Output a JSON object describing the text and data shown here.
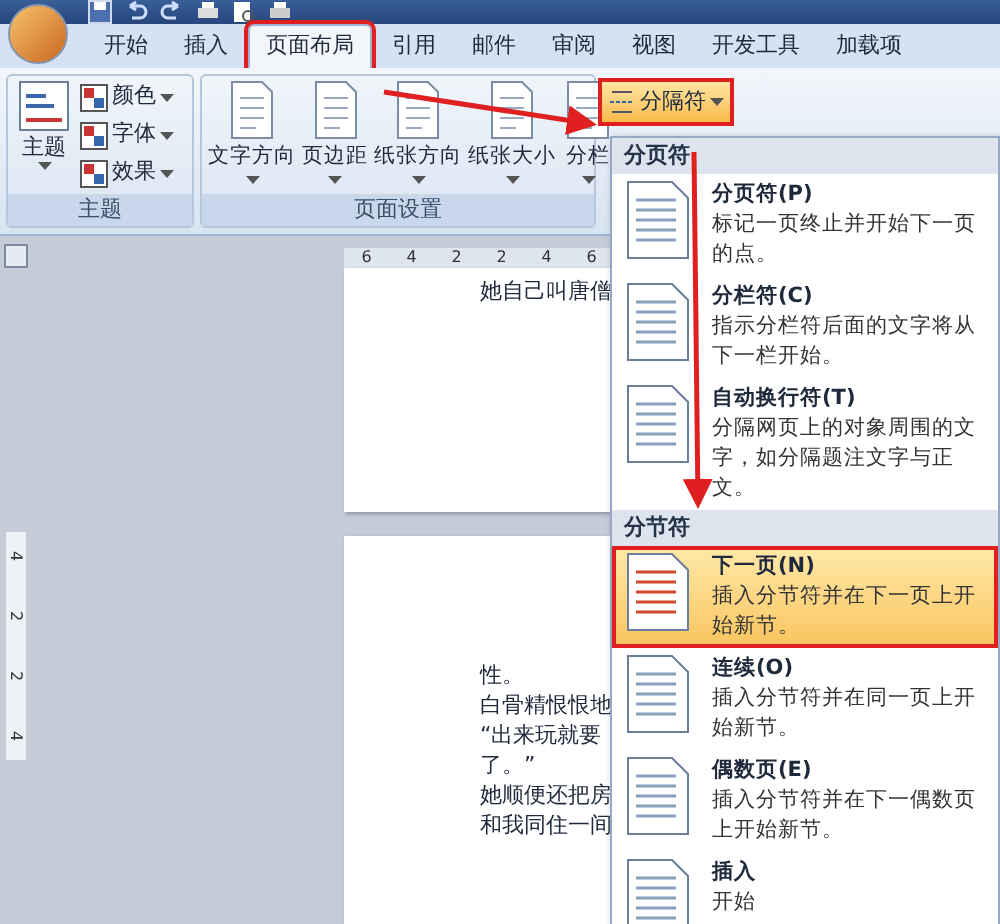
{
  "tabs": [
    {
      "label": "开始",
      "selected": false
    },
    {
      "label": "插入",
      "selected": false
    },
    {
      "label": "页面布局",
      "selected": true
    },
    {
      "label": "引用",
      "selected": false
    },
    {
      "label": "邮件",
      "selected": false
    },
    {
      "label": "审阅",
      "selected": false
    },
    {
      "label": "视图",
      "selected": false
    },
    {
      "label": "开发工具",
      "selected": false
    },
    {
      "label": "加载项",
      "selected": false
    }
  ],
  "theme_group": {
    "label": "主题",
    "big_button": "主题",
    "small_buttons": [
      "颜色",
      "字体",
      "效果"
    ]
  },
  "page_setup_group": {
    "label": "页面设置",
    "buttons": [
      "文字方向",
      "页边距",
      "纸张方向",
      "纸张大小",
      "分栏"
    ]
  },
  "breaks_button": {
    "label": "分隔符",
    "selected": true
  },
  "horizontal_ruler": [
    "6",
    "4",
    "2",
    "2",
    "4",
    "6"
  ],
  "vertical_ruler": [
    "4",
    "2",
    "2",
    "4"
  ],
  "pages": [
    {
      "lines": [
        "她自己叫唐僧"
      ]
    },
    {
      "lines": [
        "性。",
        "白骨精恨恨地",
        "“出来玩就要",
        "了。”",
        "她顺便还把房",
        "和我同住一间"
      ]
    }
  ],
  "menu": {
    "sections": [
      {
        "title": "分页符",
        "items": [
          {
            "title": "分页符(P)",
            "description": "标记一页终止并开始下一页的点。",
            "selected": false
          },
          {
            "title": "分栏符(C)",
            "description": "指示分栏符后面的文字将从下一栏开始。",
            "selected": false
          },
          {
            "title": "自动换行符(T)",
            "description": "分隔网页上的对象周围的文字，如分隔题注文字与正文。",
            "selected": false
          }
        ]
      },
      {
        "title": "分节符",
        "items": [
          {
            "title": "下一页(N)",
            "description": "插入分节符并在下一页上开始新节。",
            "selected": true
          },
          {
            "title": "连续(O)",
            "description": "插入分节符并在同一页上开始新节。",
            "selected": false
          },
          {
            "title": "偶数页(E)",
            "description": "插入分节符并在下一偶数页上开始新节。",
            "selected": false
          },
          {
            "title": "插入",
            "description": "开始",
            "selected": false
          }
        ]
      }
    ]
  }
}
